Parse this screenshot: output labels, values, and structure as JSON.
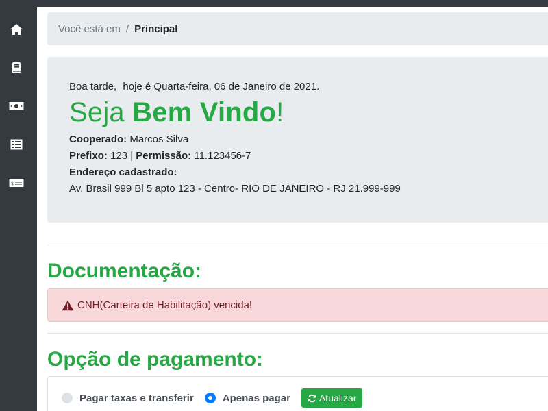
{
  "sidebar": {
    "items": [
      {
        "icon": "home-icon"
      },
      {
        "icon": "book-icon"
      },
      {
        "icon": "money-bill-icon"
      },
      {
        "icon": "list-icon"
      },
      {
        "icon": "money-check-icon"
      }
    ]
  },
  "breadcrumb": {
    "prefix": "Você está em",
    "separator": "/",
    "current": "Principal"
  },
  "welcome": {
    "greeting": "Boa tarde,",
    "date_text": "hoje é Quarta-feira, 06 de Janeiro de 2021.",
    "title_light": "Seja ",
    "title_bold": "Bem Vindo",
    "title_end": "!",
    "cooperado_label": "Cooperado:",
    "cooperado_value": " Marcos Silva",
    "prefixo_label": "Prefixo:",
    "prefixo_value": " 123 | ",
    "permissao_label": "Permissão:",
    "permissao_value": " 11.123456-7",
    "endereco_label": "Endereço cadastrado:",
    "endereco_value": "Av. Brasil 999 Bl 5 apto 123 - Centro- RIO DE JANEIRO - RJ 21.999-999"
  },
  "documentacao": {
    "heading": "Documentação:",
    "alert_text": "CNH(Carteira de Habilitação) vencida!"
  },
  "pagamento": {
    "heading": "Opção de pagamento:",
    "option_1": "Pagar taxas e transferir",
    "option_2": "Apenas pagar",
    "selected": "Apenas pagar",
    "update_button": "Atualizar"
  },
  "colors": {
    "sidebar_bg": "#343a40",
    "accent_green": "#28a745",
    "panel_bg": "#e9ecef",
    "alert_bg": "#f8d7da",
    "radio_selected": "#007bff"
  }
}
